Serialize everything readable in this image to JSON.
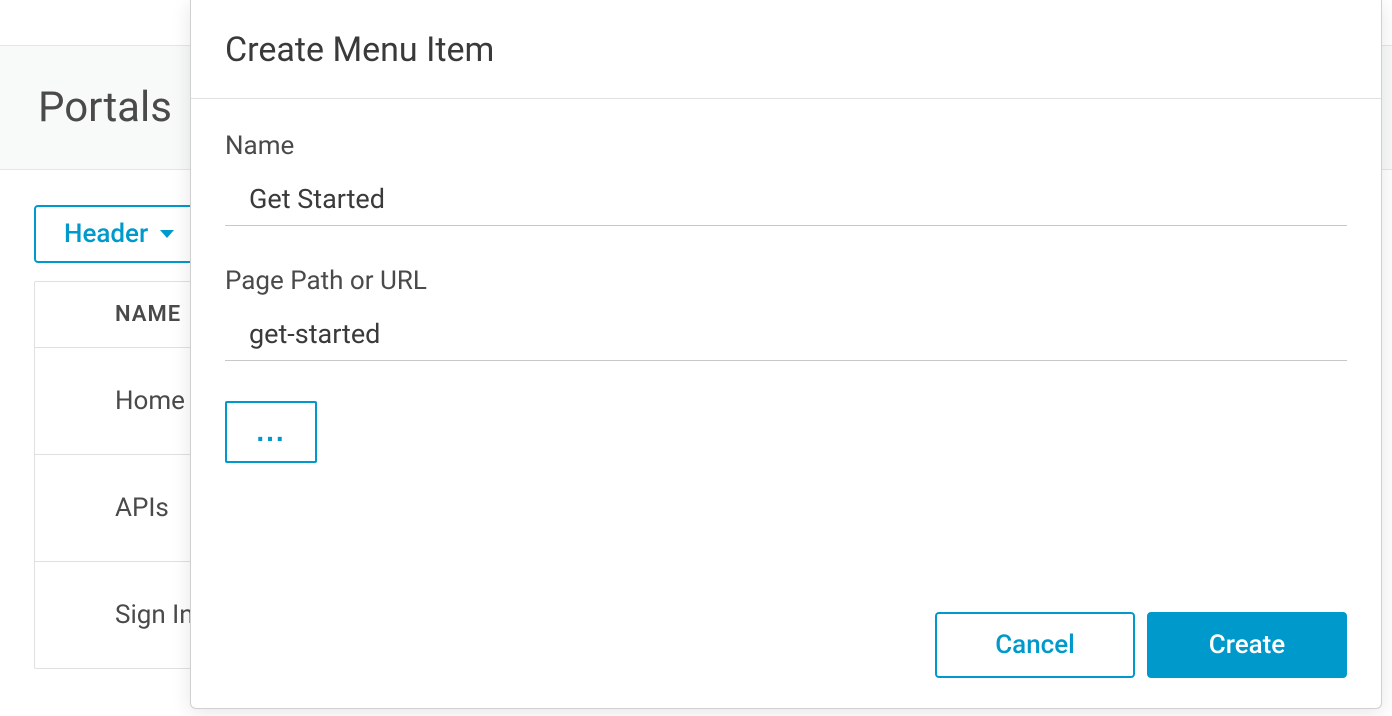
{
  "page": {
    "title": "Portals"
  },
  "dropdown": {
    "label": "Header"
  },
  "table": {
    "column_header": "NAME",
    "rows": [
      {
        "name": "Home"
      },
      {
        "name": "APIs"
      },
      {
        "name": "Sign In"
      }
    ]
  },
  "modal": {
    "title": "Create Menu Item",
    "name_label": "Name",
    "name_value": "Get Started",
    "path_label": "Page Path or URL",
    "path_value": "get-started",
    "more_label": "...",
    "cancel_label": "Cancel",
    "create_label": "Create"
  }
}
